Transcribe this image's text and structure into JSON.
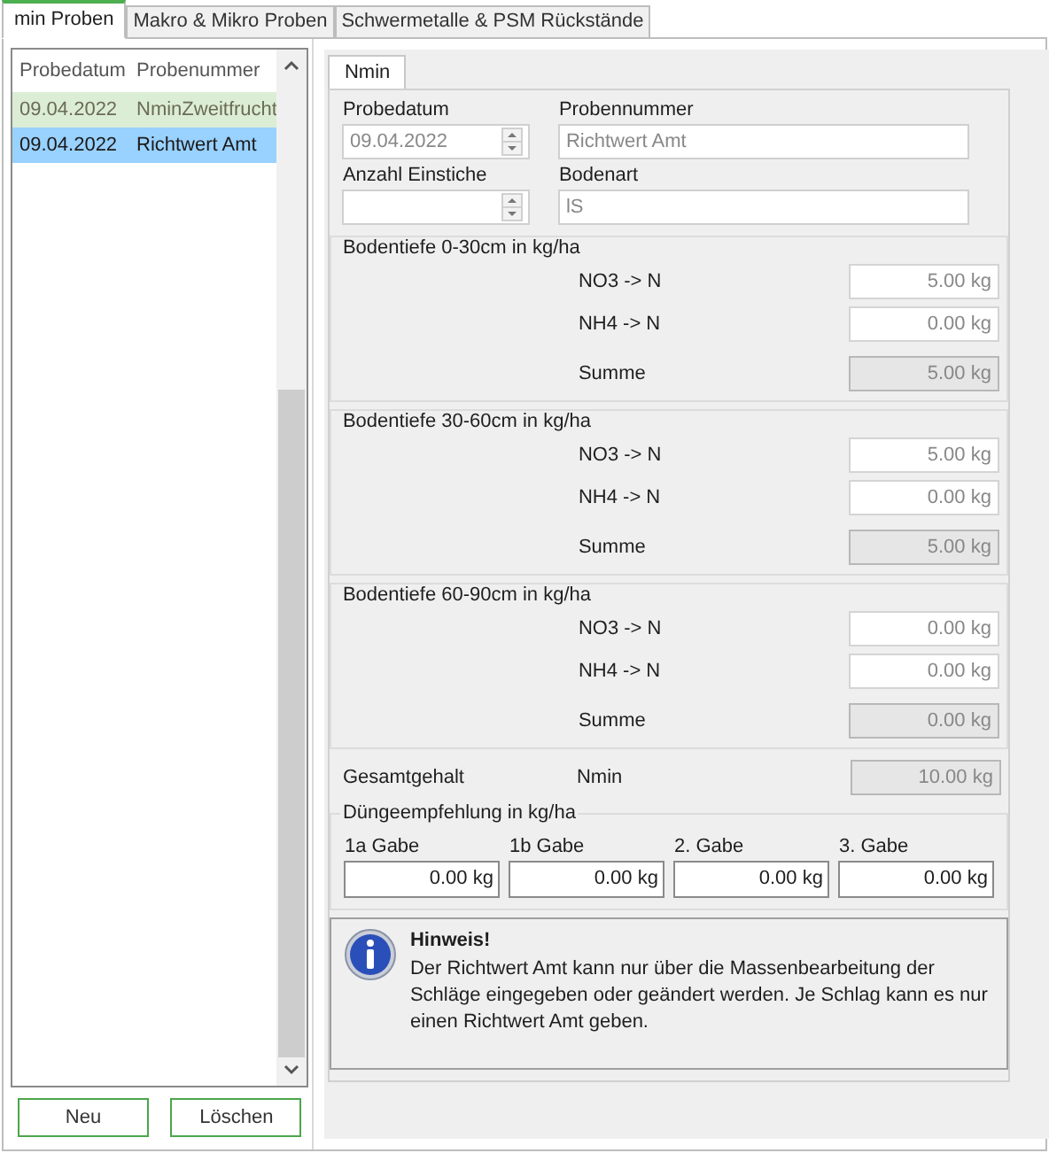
{
  "tabs": [
    {
      "label": "min Proben",
      "selected": true
    },
    {
      "label": "Makro & Mikro Proben",
      "selected": false
    },
    {
      "label": "Schwermetalle & PSM Rückstände",
      "selected": false
    }
  ],
  "list": {
    "columns": [
      "Probedatum",
      "Probenummer"
    ],
    "rows": [
      {
        "date": "09.04.2022",
        "number": "NminZweitfrucht",
        "highlighted": true,
        "selected": false
      },
      {
        "date": "09.04.2022",
        "number": "Richtwert Amt",
        "highlighted": false,
        "selected": true
      }
    ]
  },
  "buttons": [
    "Neu",
    "Löschen"
  ],
  "detail_tab": {
    "label": "Nmin",
    "selected": true
  },
  "fields": [
    {
      "label": "Probedatum",
      "value": "09.04.2022",
      "kind": "spinner"
    },
    {
      "label": "Probennummer",
      "value": "Richtwert Amt",
      "kind": "text"
    },
    {
      "label": "Anzahl Einstiche",
      "kind": "spinner"
    },
    {
      "label": "Bodenart",
      "value": "lS",
      "kind": "text"
    }
  ],
  "depth_groups": [
    {
      "title": "Bodentiefe 0-30cm in kg/ha",
      "rows": [
        {
          "label": "NO3 -> N",
          "value": "5.00 kg",
          "disabled": false
        },
        {
          "label": "NH4 -> N",
          "value": "0.00 kg",
          "disabled": false
        },
        {
          "label": "Summe",
          "value": "5.00 kg",
          "disabled": true
        }
      ]
    },
    {
      "title": "Bodentiefe 30-60cm in kg/ha",
      "rows": [
        {
          "label": "NO3 -> N",
          "value": "5.00 kg",
          "disabled": false
        },
        {
          "label": "NH4 -> N",
          "value": "0.00 kg",
          "disabled": false
        },
        {
          "label": "Summe",
          "value": "5.00 kg",
          "disabled": true
        }
      ]
    },
    {
      "title": "Bodentiefe 60-90cm in kg/ha",
      "rows": [
        {
          "label": "NO3 -> N",
          "value": "0.00 kg",
          "disabled": false
        },
        {
          "label": "NH4 -> N",
          "value": "0.00 kg",
          "disabled": false
        },
        {
          "label": "Summe",
          "value": "0.00 kg",
          "disabled": true
        }
      ]
    }
  ],
  "total": {
    "label": "Gesamtgehalt",
    "sublabel": "Nmin",
    "value": "10.00 kg",
    "disabled": true
  },
  "recommendation": {
    "title": "Düngeempfehlung in kg/ha",
    "items": [
      {
        "label": "1a Gabe",
        "value": "0.00 kg"
      },
      {
        "label": "1b Gabe",
        "value": "0.00 kg"
      },
      {
        "label": "2. Gabe",
        "value": "0.00 kg"
      },
      {
        "label": "3. Gabe",
        "value": "0.00 kg"
      }
    ]
  },
  "notice": {
    "title": "Hinweis!",
    "text": "Der Richtwert Amt kann nur über die Massenbearbeitung der Schläge eingegeben oder geändert werden. Je Schlag kann es nur einen Richtwert Amt geben."
  }
}
